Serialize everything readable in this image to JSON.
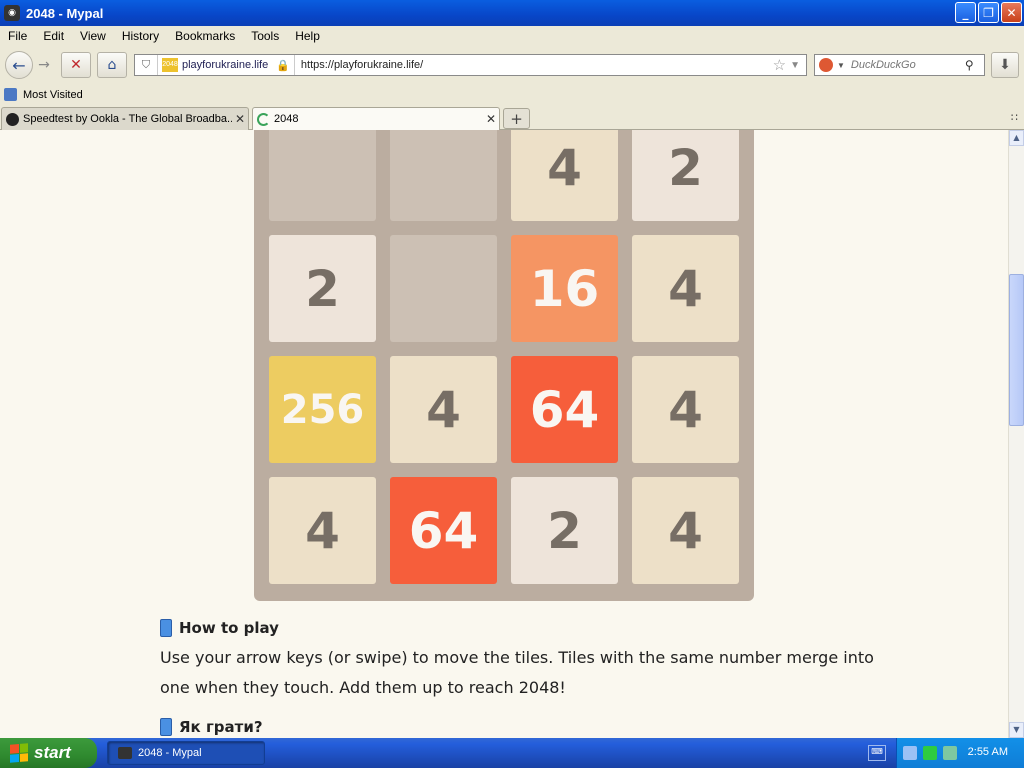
{
  "window": {
    "title": "2048 - Mypal"
  },
  "menu": [
    "File",
    "Edit",
    "View",
    "History",
    "Bookmarks",
    "Tools",
    "Help"
  ],
  "nav": {
    "site_label": "playforukraine.life",
    "url": "https://playforukraine.life/",
    "search_placeholder": "DuckDuckGo"
  },
  "bookmarks": {
    "most_visited": "Most Visited"
  },
  "tabs": [
    {
      "label": "Speedtest by Ookla - The Global Broadba..."
    },
    {
      "label": "2048"
    }
  ],
  "game": {
    "tile_colors": {
      "2": "#eee4da",
      "4": "#ede0c8",
      "16": "#f59563",
      "64": "#f65e3b",
      "256": "#edcc61"
    },
    "grid": [
      [
        "",
        "",
        "4",
        "2"
      ],
      [
        "2",
        "",
        "16",
        "4"
      ],
      [
        "256",
        "4",
        "64",
        "4"
      ],
      [
        "4",
        "64",
        "2",
        "4"
      ]
    ]
  },
  "instructions": {
    "title": "How to play",
    "text": "Use your arrow keys (or swipe) to move the tiles. Tiles with the same number merge into one when they touch. Add them up to reach 2048!",
    "title_uk": "Як грати?"
  },
  "taskbar": {
    "start": "start",
    "task": "2048 - Mypal",
    "clock": "2:55 AM"
  }
}
